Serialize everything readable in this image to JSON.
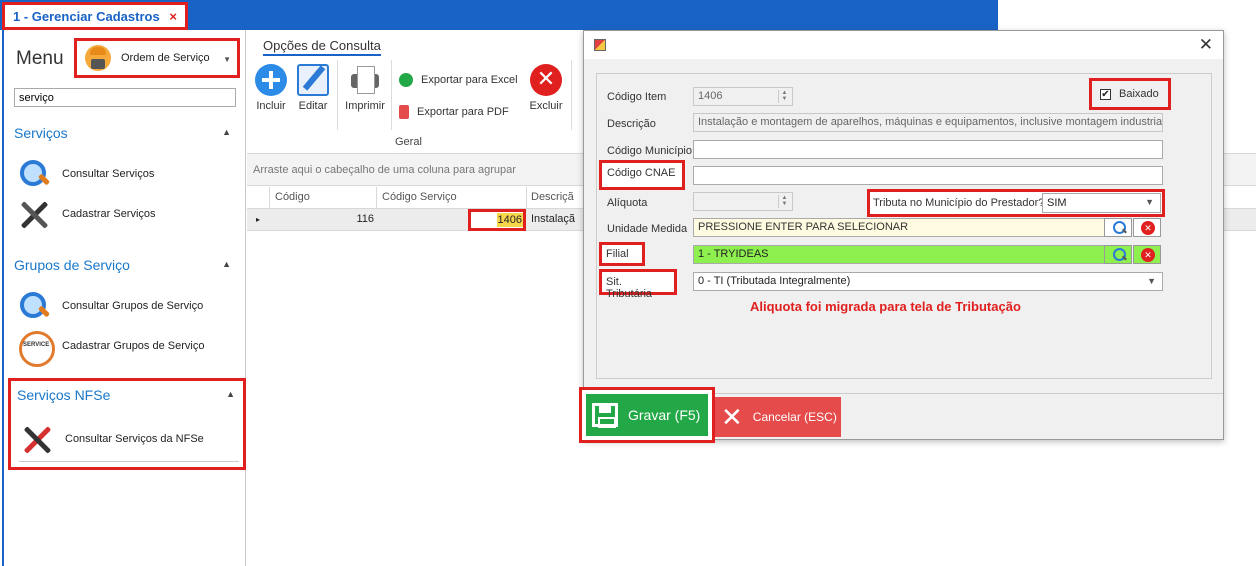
{
  "window_tab": {
    "title": "1 - Gerenciar Cadastros",
    "close": "×"
  },
  "menu": {
    "title": "Menu",
    "module_select": "Ordem de Serviço",
    "search_value": "serviço",
    "sections": [
      {
        "title": "Serviços",
        "items": [
          "Consultar Serviços",
          "Cadastrar Serviços"
        ]
      },
      {
        "title": "Grupos de Serviço",
        "items": [
          "Consultar Grupos de Serviço",
          "Cadastrar Grupos de Serviço"
        ]
      },
      {
        "title": "Serviços NFSe",
        "items": [
          "Consultar Serviços da NFSe"
        ]
      }
    ]
  },
  "ribbon": {
    "tab": "Opções de Consulta",
    "buttons": {
      "incluir": "Incluir",
      "editar": "Editar",
      "imprimir": "Imprimir",
      "excel": "Exportar para Excel",
      "pdf": "Exportar para PDF",
      "excluir": "Excluir"
    },
    "group_label": "Geral"
  },
  "grid": {
    "group_hint": "Arraste aqui o cabeçalho de uma coluna para agrupar",
    "columns": [
      "Código",
      "Código Serviço",
      "Descriçã"
    ],
    "rows": [
      {
        "codigo": "116",
        "codigo_servico": "1406",
        "descricao": "Instalaçã"
      }
    ]
  },
  "dialog": {
    "close": "✕",
    "labels": {
      "codigo_item": "Código Item",
      "descricao": "Descrição",
      "codigo_municipio": "Código Município",
      "codigo_cnae": "Código CNAE",
      "aliquota": "Alíquota",
      "tributa": "Tributa no Município do Prestador?",
      "unidade_medida": "Unidade Medida",
      "filial": "Filial",
      "sit_tributaria": "Sit. Tributária"
    },
    "values": {
      "codigo_item": "1406",
      "descricao": "Instalação e montagem de aparelhos, máquinas e equipamentos, inclusive montagem industrial, ...",
      "codigo_municipio": "",
      "codigo_cnae": "",
      "aliquota": "",
      "tributa": "SIM",
      "unidade_medida": "PRESSIONE ENTER PARA SELECIONAR",
      "filial": "1 - TRYIDEAS",
      "sit_tributaria": "0 - TI (Tributada Integralmente)"
    },
    "baixado_label": "Baixado",
    "baixado_checked": true,
    "warning": "Aliquota foi migrada para tela de Tributação",
    "buttons": {
      "gravar": "Gravar (F5)",
      "cancelar": "Cancelar (ESC)"
    }
  },
  "colors": {
    "accent": "#1a63c6",
    "highlight": "#e0201f",
    "success": "#22a847",
    "danger": "#e54b4b",
    "filial_bg": "#8ef04f",
    "unidade_bg": "#fffbe0"
  }
}
